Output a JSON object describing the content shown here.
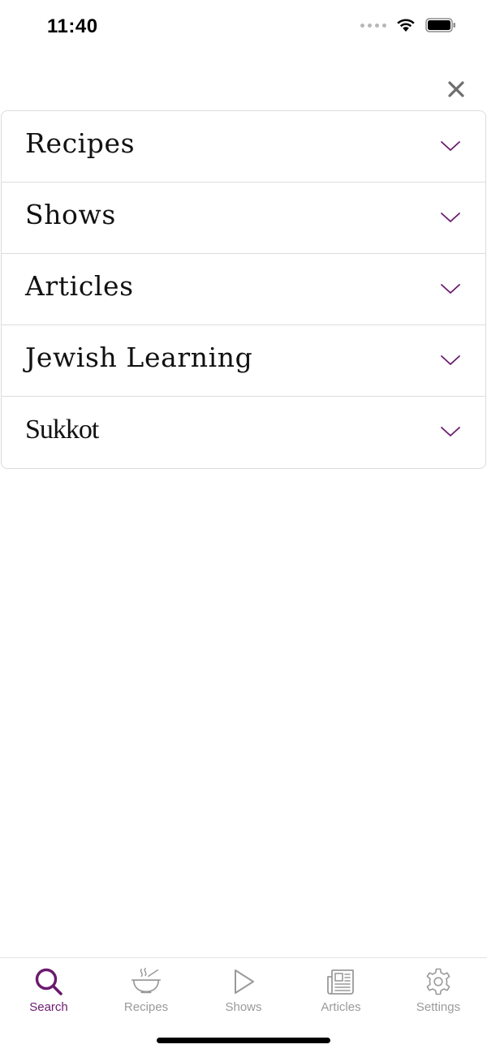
{
  "status_bar": {
    "time": "11:40",
    "icons": [
      "signal-dots-icon",
      "wifi-icon",
      "battery-icon"
    ]
  },
  "header": {
    "close_icon": "close-icon"
  },
  "accordion": {
    "items": [
      {
        "label": "Recipes"
      },
      {
        "label": "Shows"
      },
      {
        "label": "Articles"
      },
      {
        "label": "Jewish Learning"
      },
      {
        "label": "Sukkot"
      }
    ],
    "chevron_icon": "chevron-down-icon"
  },
  "tab_bar": {
    "active": "Search",
    "tabs": [
      {
        "label": "Search",
        "icon": "search-icon"
      },
      {
        "label": "Recipes",
        "icon": "bowl-icon"
      },
      {
        "label": "Shows",
        "icon": "play-icon"
      },
      {
        "label": "Articles",
        "icon": "newspaper-icon"
      },
      {
        "label": "Settings",
        "icon": "gear-icon"
      }
    ]
  },
  "colors": {
    "accent": "#6b1a6e",
    "inactive": "#9a9a9a",
    "divider": "#dcdcdc",
    "close": "#6e6e6e"
  }
}
